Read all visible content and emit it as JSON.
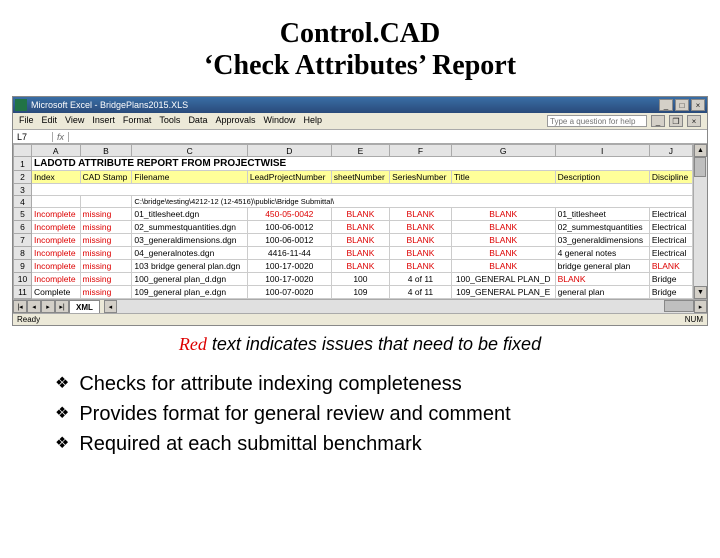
{
  "slide": {
    "title_line1": "Control.CAD",
    "title_line2": "‘Check Attributes’ Report"
  },
  "excel": {
    "app_name": "Microsoft Excel",
    "file_name": "BridgePlans2015.XLS",
    "menu": [
      "File",
      "Edit",
      "View",
      "Insert",
      "Format",
      "Tools",
      "Data",
      "Approvals",
      "Window",
      "Help"
    ],
    "help_placeholder": "Type a question for help",
    "namebox": "L7",
    "fx_label": "fx",
    "formula_value": "",
    "sheet_tab": "XML",
    "status": "Ready",
    "status_right": "NUM",
    "columns": [
      "",
      "A",
      "B",
      "C",
      "D",
      "E",
      "F",
      "G",
      "I",
      "J"
    ],
    "report_title": "LADOTD ATTRIBUTE REPORT FROM PROJECTWISE",
    "headers": [
      "Index",
      "CAD Stamp",
      "Filename",
      "LeadProjectNumber",
      "sheetNumber",
      "SeriesNumber",
      "Title",
      "Description",
      "Discipline"
    ],
    "path_prefix": "C:\\bridge\\testing\\4212-12 (12-4516)\\public\\Bridge Submittal\\",
    "data_rows": [
      {
        "n": "5",
        "index": [
          "Incomplete",
          "red"
        ],
        "stamp": [
          "missing",
          "red"
        ],
        "file": "01_titlesheet.dgn",
        "lpn": [
          "450-05-0042",
          "red"
        ],
        "sheet": [
          "BLANK",
          "red"
        ],
        "series": [
          "BLANK",
          "red"
        ],
        "title": [
          "BLANK",
          "red"
        ],
        "desc": "01_titlesheet",
        "disc": "Electrical"
      },
      {
        "n": "6",
        "index": [
          "Incomplete",
          "red"
        ],
        "stamp": [
          "missing",
          "red"
        ],
        "file": "02_summestquantities.dgn",
        "lpn": [
          "100-06-0012",
          ""
        ],
        "sheet": [
          "BLANK",
          "red"
        ],
        "series": [
          "BLANK",
          "red"
        ],
        "title": [
          "BLANK",
          "red"
        ],
        "desc": "02_summestquantities",
        "disc": "Electrical"
      },
      {
        "n": "7",
        "index": [
          "Incomplete",
          "red"
        ],
        "stamp": [
          "missing",
          "red"
        ],
        "file": "03_generaldimensions.dgn",
        "lpn": [
          "100-06-0012",
          ""
        ],
        "sheet": [
          "BLANK",
          "red"
        ],
        "series": [
          "BLANK",
          "red"
        ],
        "title": [
          "BLANK",
          "red"
        ],
        "desc": "03_generaldimensions",
        "disc": "Electrical"
      },
      {
        "n": "8",
        "index": [
          "Incomplete",
          "red"
        ],
        "stamp": [
          "missing",
          "red"
        ],
        "file": "04_generalnotes.dgn",
        "lpn": [
          "4416-11-44",
          ""
        ],
        "sheet": [
          "BLANK",
          "red"
        ],
        "series": [
          "BLANK",
          "red"
        ],
        "title": [
          "BLANK",
          "red"
        ],
        "desc": "4 general notes",
        "disc": "Electrical"
      },
      {
        "n": "9",
        "index": [
          "Incomplete",
          "red"
        ],
        "stamp": [
          "missing",
          "red"
        ],
        "file": "103 bridge general plan.dgn",
        "lpn": [
          "100-17-0020",
          ""
        ],
        "sheet": [
          "BLANK",
          "red"
        ],
        "series": [
          "BLANK",
          "red"
        ],
        "title": [
          "BLANK",
          "red"
        ],
        "desc": "bridge general plan",
        "disc": [
          "BLANK",
          "red"
        ]
      },
      {
        "n": "10",
        "index": [
          "Incomplete",
          "red"
        ],
        "stamp": [
          "missing",
          "red"
        ],
        "file": "100_general plan_d.dgn",
        "lpn": [
          "100-17-0020",
          ""
        ],
        "sheet": "100",
        "series": "4 of 11",
        "title": "100_GENERAL PLAN_D",
        "desc": [
          "BLANK",
          "red"
        ],
        "disc": "Bridge"
      },
      {
        "n": "11",
        "index": "Complete",
        "stamp": [
          "missing",
          "red"
        ],
        "file": "109_general plan_e.dgn",
        "lpn": [
          "100-07-0020",
          ""
        ],
        "sheet": "109",
        "series": "4 of 11",
        "title": "109_GENERAL PLAN_E",
        "desc": "general plan",
        "disc": "Bridge"
      }
    ]
  },
  "caption": {
    "red_word": "Red",
    "rest": " text indicates issues that need to be fixed"
  },
  "bullets": [
    "Checks for attribute indexing completeness",
    "Provides format for general review and comment",
    "Required at each submittal benchmark"
  ]
}
